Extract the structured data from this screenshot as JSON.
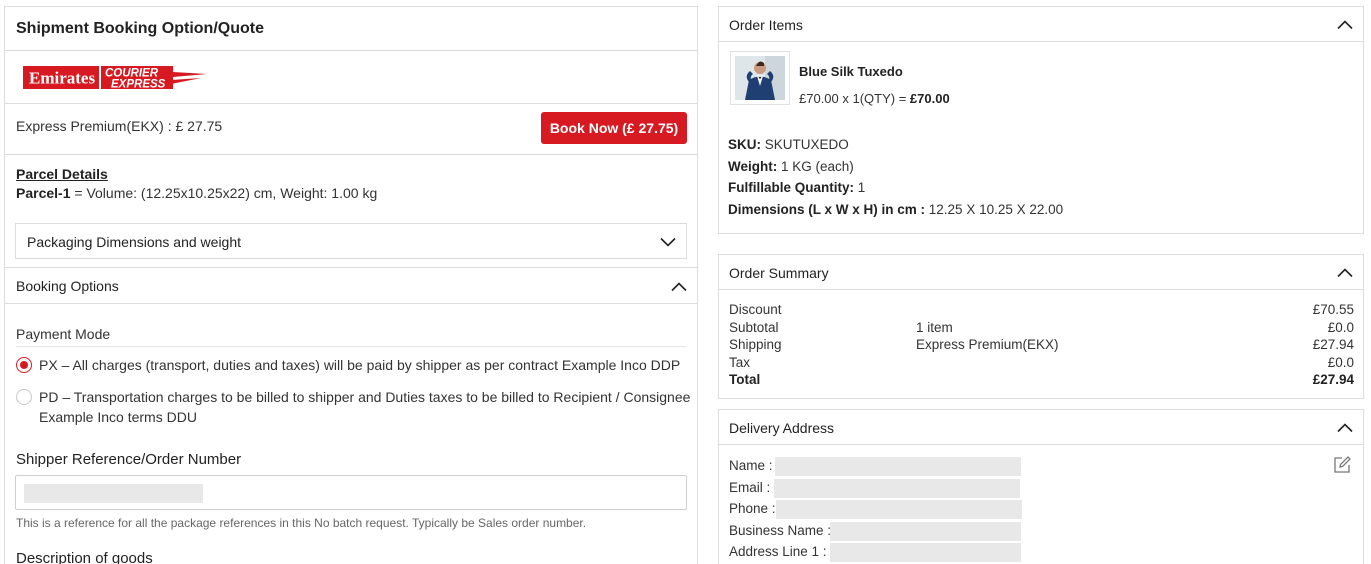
{
  "left": {
    "section_title": "Shipment Booking Option/Quote",
    "logo": {
      "line1": "Emirates",
      "line2": "COURIER",
      "line3": "EXPRESS"
    },
    "quote_text": "Express Premium(EKX) : £ 27.75",
    "book_button": "Book Now (£ 27.75)",
    "parcel_title": "Parcel Details",
    "parcel_label": "Parcel-1",
    "parcel_detail": " = Volume: (12.25x10.25x22) cm, Weight: 1.00 kg",
    "packaging_toggle": "Packaging Dimensions and weight",
    "booking_options": "Booking Options",
    "payment_mode_label": "Payment Mode",
    "payment_options": [
      {
        "label": "PX – All charges (transport, duties and taxes) will be paid by shipper as per contract Example Inco DDP",
        "selected": true
      },
      {
        "label": "PD – Transportation charges to be billed to shipper and Duties taxes to be billed to Recipient / Consignee Example Inco terms DDU",
        "selected": false
      }
    ],
    "shipper_ref_label": "Shipper Reference/Order Number",
    "shipper_ref_help": "This is a reference for all the package references in this No batch request. Typically be Sales order number.",
    "description_label": "Description of goods"
  },
  "order_items": {
    "title": "Order Items",
    "product_name": "Blue Silk Tuxedo",
    "price_prefix": "£70.00 x 1(QTY) = ",
    "price_total": "£70.00",
    "sku_label": "SKU:",
    "sku_value": " SKUTUXEDO",
    "weight_label": "Weight:",
    "weight_value": " 1 KG (each)",
    "qty_label": "Fulfillable Quantity:",
    "qty_value": " 1",
    "dims_label": "Dimensions (L x W x H) in cm :",
    "dims_value": " 12.25 X 10.25 X 22.00"
  },
  "order_summary": {
    "title": "Order Summary",
    "rows": [
      {
        "label": "Discount",
        "mid": "",
        "value": "£70.55"
      },
      {
        "label": "Subtotal",
        "mid": "1 item",
        "value": "£0.0"
      },
      {
        "label": "Shipping",
        "mid": "Express Premium(EKX)",
        "value": "£27.94"
      },
      {
        "label": "Tax",
        "mid": "",
        "value": "£0.0"
      },
      {
        "label": "Total",
        "mid": "",
        "value": "£27.94"
      }
    ]
  },
  "delivery_address": {
    "title": "Delivery Address",
    "fields": [
      {
        "label": "Name :"
      },
      {
        "label": "Email :"
      },
      {
        "label": "Phone :"
      },
      {
        "label": "Business Name :"
      },
      {
        "label": "Address Line 1 :"
      }
    ]
  },
  "colors": {
    "accent": "#d71921"
  },
  "icons": {
    "chevron_up": "chevron-up-icon",
    "chevron_down": "chevron-down-icon",
    "edit": "edit-icon"
  }
}
